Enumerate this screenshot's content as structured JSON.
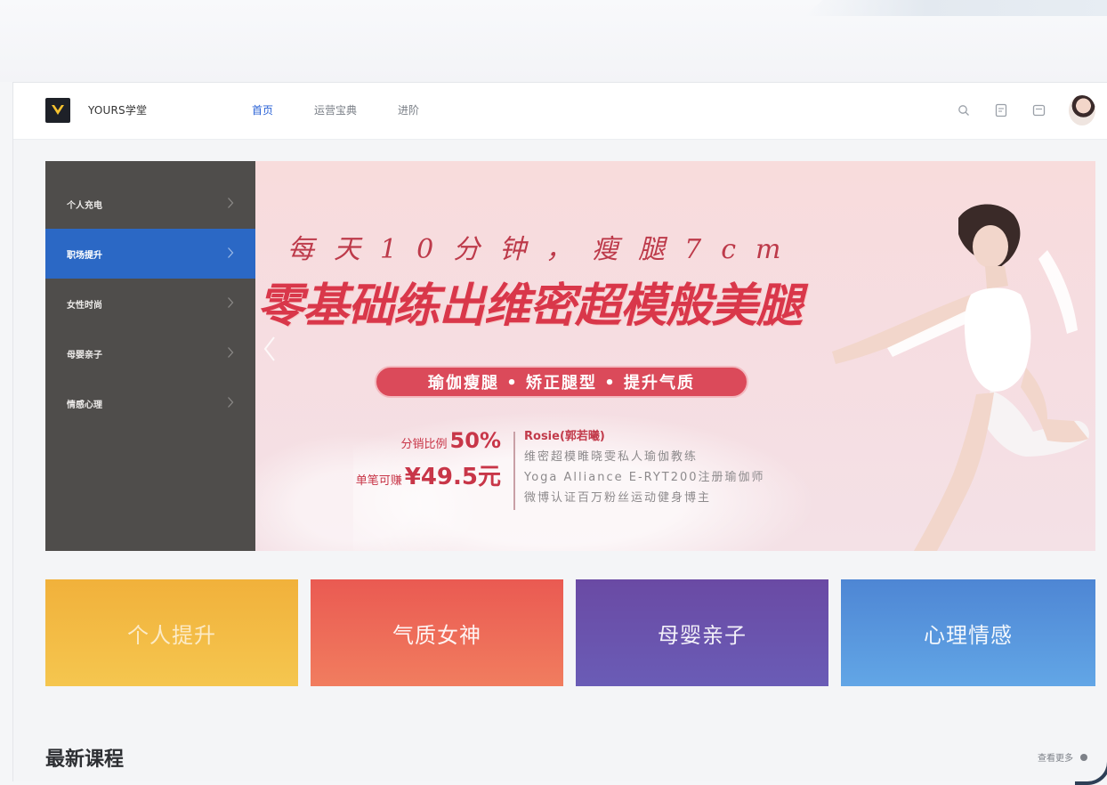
{
  "header": {
    "brand": "YOURS学堂",
    "nav": [
      {
        "label": "首页",
        "active": true
      },
      {
        "label": "运营宝典",
        "active": false
      },
      {
        "label": "进阶",
        "active": false
      }
    ],
    "icons": [
      "search-icon",
      "notes-icon",
      "message-icon",
      "avatar"
    ]
  },
  "sidebar": {
    "items": [
      {
        "label": "个人充电",
        "active": false
      },
      {
        "label": "职场提升",
        "active": true
      },
      {
        "label": "女性时尚",
        "active": false
      },
      {
        "label": "母婴亲子",
        "active": false
      },
      {
        "label": "情感心理",
        "active": false
      }
    ]
  },
  "banner": {
    "line1": "每天10分钟，瘦腿7cm",
    "line2": "零基础练出维密超模般美腿",
    "pill": "瑜伽瘦腿 • 矫正腿型 • 提升气质",
    "left_row1_label": "分销比例",
    "left_row1_value": "50%",
    "left_row2_label": "单笔可赚",
    "left_row2_value": "¥49.5元",
    "teacher_name": "Rosie(郭若曦)",
    "teacher_desc": [
      "维密超模睢晓雯私人瑜伽教练",
      "Yoga Alliance E-RYT200注册瑜伽师",
      "微博认证百万粉丝运动健身博主"
    ]
  },
  "categories": [
    {
      "label": "个人提升",
      "color": "#f3b844"
    },
    {
      "label": "气质女神",
      "color": "#ee6a58"
    },
    {
      "label": "母婴亲子",
      "color": "#6a52ac"
    },
    {
      "label": "心理情感",
      "color": "#5896dc"
    }
  ],
  "latest": {
    "title": "最新课程",
    "see_more": "查看更多"
  },
  "colors": {
    "accent": "#2a62d6",
    "sidebar_bg": "#4f4d4b",
    "sidebar_active": "#2b68c5",
    "banner_red": "#d9374a"
  }
}
